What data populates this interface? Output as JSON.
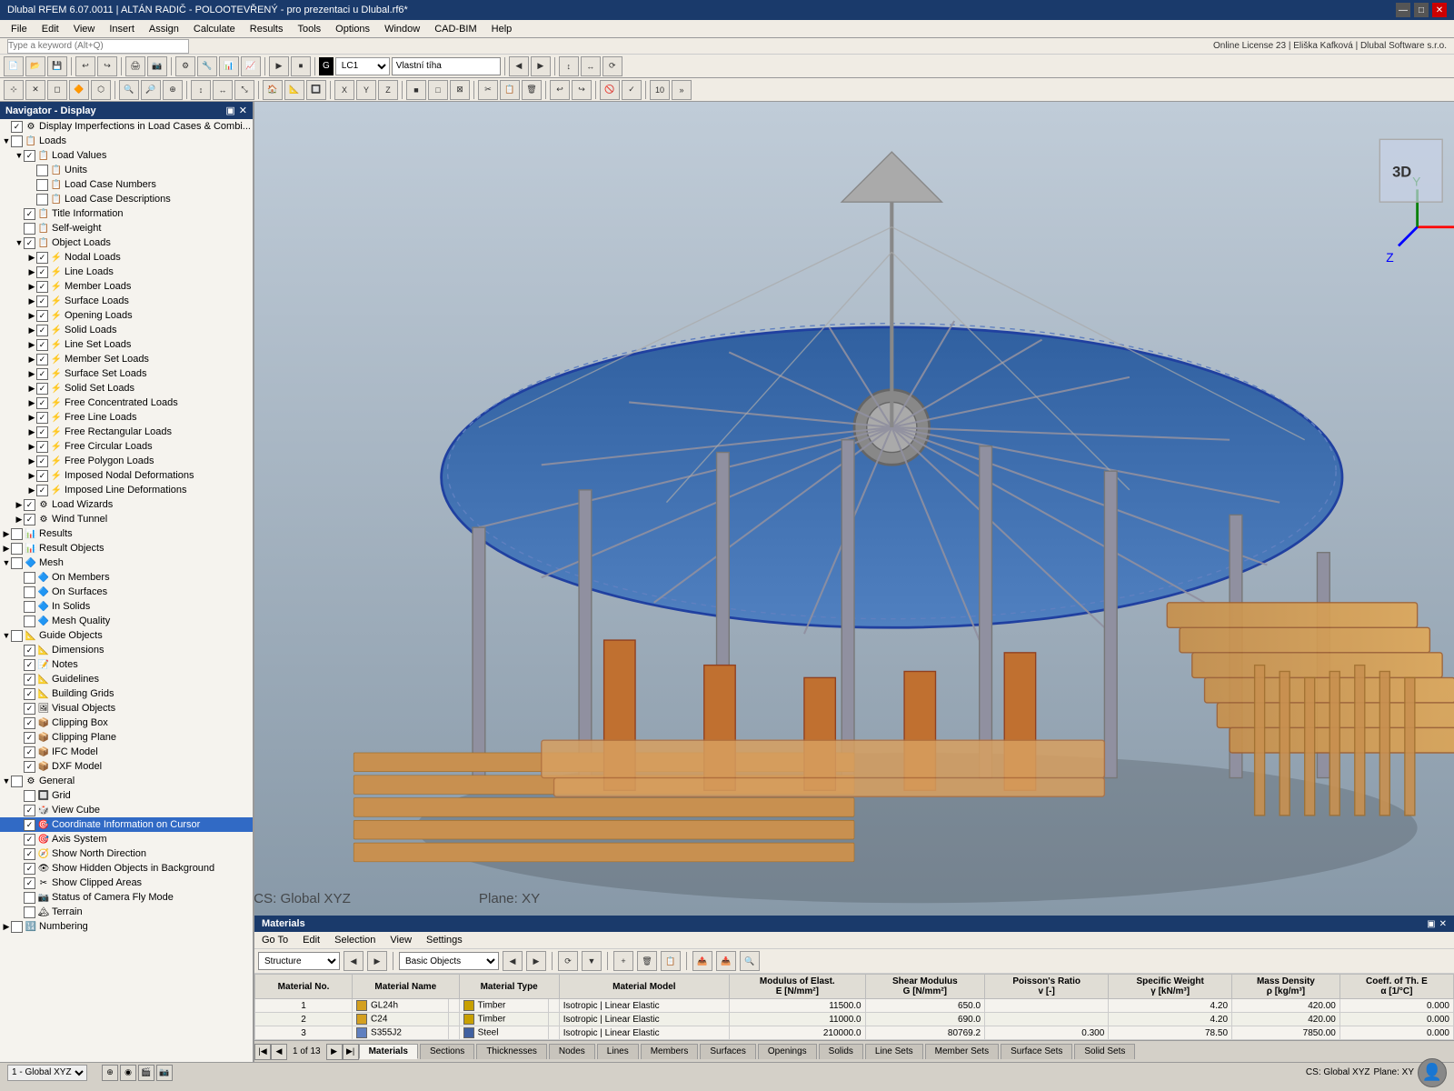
{
  "window": {
    "title": "Dlubal RFEM 6.07.0011 | ALTÁN RADIČ - POLOOTEVŘENÝ - pro prezentaci u Dlubal.rf6*",
    "minimize": "—",
    "maximize": "□",
    "close": "✕"
  },
  "menu": {
    "items": [
      "File",
      "Edit",
      "View",
      "Insert",
      "Assign",
      "Calculate",
      "Results",
      "Tools",
      "Options",
      "Window",
      "CAD-BIM",
      "Help"
    ]
  },
  "license_bar": {
    "search_placeholder": "Type a keyword (Alt+Q)",
    "license_text": "Online License 23 | Eliška Kafková | Dlubal Software s.r.o."
  },
  "toolbar1": {
    "dropdown_lc": "LC1",
    "load_case_name": "Vlastní tíha"
  },
  "navigator": {
    "title": "Navigator - Display",
    "items": [
      {
        "id": "display-imperfections",
        "label": "Display Imperfections in Load Cases & Combi...",
        "checked": true,
        "level": 0,
        "expandable": false,
        "icon": "⚙"
      },
      {
        "id": "loads",
        "label": "Loads",
        "checked": false,
        "level": 0,
        "expandable": true,
        "expanded": true,
        "icon": "📋"
      },
      {
        "id": "load-values",
        "label": "Load Values",
        "checked": true,
        "level": 1,
        "expandable": true,
        "expanded": true,
        "icon": "📋"
      },
      {
        "id": "units",
        "label": "Units",
        "checked": false,
        "level": 2,
        "expandable": false,
        "icon": "📋"
      },
      {
        "id": "load-case-numbers",
        "label": "Load Case Numbers",
        "checked": false,
        "level": 2,
        "expandable": false,
        "icon": "📋"
      },
      {
        "id": "load-case-descriptions",
        "label": "Load Case Descriptions",
        "checked": false,
        "level": 2,
        "expandable": false,
        "icon": "📋"
      },
      {
        "id": "title-information",
        "label": "Title Information",
        "checked": true,
        "level": 1,
        "expandable": false,
        "icon": "📋"
      },
      {
        "id": "self-weight",
        "label": "Self-weight",
        "checked": false,
        "level": 1,
        "expandable": false,
        "icon": "📋"
      },
      {
        "id": "object-loads",
        "label": "Object Loads",
        "checked": true,
        "level": 1,
        "expandable": true,
        "expanded": true,
        "icon": "📋"
      },
      {
        "id": "nodal-loads",
        "label": "Nodal Loads",
        "checked": true,
        "level": 2,
        "expandable": true,
        "icon": "⚡"
      },
      {
        "id": "line-loads",
        "label": "Line Loads",
        "checked": true,
        "level": 2,
        "expandable": true,
        "icon": "⚡"
      },
      {
        "id": "member-loads",
        "label": "Member Loads",
        "checked": true,
        "level": 2,
        "expandable": true,
        "icon": "⚡"
      },
      {
        "id": "surface-loads",
        "label": "Surface Loads",
        "checked": true,
        "level": 2,
        "expandable": true,
        "icon": "⚡"
      },
      {
        "id": "opening-loads",
        "label": "Opening Loads",
        "checked": true,
        "level": 2,
        "expandable": true,
        "icon": "⚡"
      },
      {
        "id": "solid-loads",
        "label": "Solid Loads",
        "checked": true,
        "level": 2,
        "expandable": true,
        "icon": "⚡"
      },
      {
        "id": "line-set-loads",
        "label": "Line Set Loads",
        "checked": true,
        "level": 2,
        "expandable": true,
        "icon": "⚡"
      },
      {
        "id": "member-set-loads",
        "label": "Member Set Loads",
        "checked": true,
        "level": 2,
        "expandable": true,
        "icon": "⚡"
      },
      {
        "id": "surface-set-loads",
        "label": "Surface Set Loads",
        "checked": true,
        "level": 2,
        "expandable": true,
        "icon": "⚡"
      },
      {
        "id": "solid-set-loads",
        "label": "Solid Set Loads",
        "checked": true,
        "level": 2,
        "expandable": true,
        "icon": "⚡"
      },
      {
        "id": "free-concentrated-loads",
        "label": "Free Concentrated Loads",
        "checked": true,
        "level": 2,
        "expandable": true,
        "icon": "⚡"
      },
      {
        "id": "free-line-loads",
        "label": "Free Line Loads",
        "checked": true,
        "level": 2,
        "expandable": true,
        "icon": "⚡"
      },
      {
        "id": "free-rectangular-loads",
        "label": "Free Rectangular Loads",
        "checked": true,
        "level": 2,
        "expandable": true,
        "icon": "⚡"
      },
      {
        "id": "free-circular-loads",
        "label": "Free Circular Loads",
        "checked": true,
        "level": 2,
        "expandable": true,
        "icon": "⚡"
      },
      {
        "id": "free-polygon-loads",
        "label": "Free Polygon Loads",
        "checked": true,
        "level": 2,
        "expandable": true,
        "icon": "⚡"
      },
      {
        "id": "imposed-nodal",
        "label": "Imposed Nodal Deformations",
        "checked": true,
        "level": 2,
        "expandable": true,
        "icon": "⚡"
      },
      {
        "id": "imposed-line",
        "label": "Imposed Line Deformations",
        "checked": true,
        "level": 2,
        "expandable": true,
        "icon": "⚡"
      },
      {
        "id": "load-wizards",
        "label": "Load Wizards",
        "checked": true,
        "level": 1,
        "expandable": true,
        "icon": "⚙"
      },
      {
        "id": "wind-tunnel",
        "label": "Wind Tunnel",
        "checked": true,
        "level": 1,
        "expandable": true,
        "icon": "⚙"
      },
      {
        "id": "results",
        "label": "Results",
        "checked": false,
        "level": 0,
        "expandable": true,
        "expanded": false,
        "icon": "📊"
      },
      {
        "id": "result-objects",
        "label": "Result Objects",
        "checked": false,
        "level": 0,
        "expandable": true,
        "expanded": false,
        "icon": "📊"
      },
      {
        "id": "mesh",
        "label": "Mesh",
        "checked": false,
        "level": 0,
        "expandable": true,
        "expanded": true,
        "icon": "🔷"
      },
      {
        "id": "on-members",
        "label": "On Members",
        "checked": false,
        "level": 1,
        "expandable": false,
        "icon": "🔷"
      },
      {
        "id": "on-surfaces",
        "label": "On Surfaces",
        "checked": false,
        "level": 1,
        "expandable": false,
        "icon": "🔷"
      },
      {
        "id": "in-solids",
        "label": "In Solids",
        "checked": false,
        "level": 1,
        "expandable": false,
        "icon": "🔷"
      },
      {
        "id": "mesh-quality",
        "label": "Mesh Quality",
        "checked": false,
        "level": 1,
        "expandable": false,
        "icon": "🔷"
      },
      {
        "id": "guide-objects",
        "label": "Guide Objects",
        "checked": false,
        "level": 0,
        "expandable": true,
        "expanded": true,
        "icon": "📐"
      },
      {
        "id": "dimensions",
        "label": "Dimensions",
        "checked": true,
        "level": 1,
        "expandable": false,
        "icon": "📐"
      },
      {
        "id": "notes",
        "label": "Notes",
        "checked": true,
        "level": 1,
        "expandable": false,
        "icon": "📝"
      },
      {
        "id": "guidelines",
        "label": "Guidelines",
        "checked": true,
        "level": 1,
        "expandable": false,
        "icon": "📐"
      },
      {
        "id": "building-grids",
        "label": "Building Grids",
        "checked": true,
        "level": 1,
        "expandable": false,
        "icon": "📐"
      },
      {
        "id": "visual-objects",
        "label": "Visual Objects",
        "checked": true,
        "level": 1,
        "expandable": false,
        "icon": "🖼"
      },
      {
        "id": "clipping-box",
        "label": "Clipping Box",
        "checked": true,
        "level": 1,
        "expandable": false,
        "icon": "📦"
      },
      {
        "id": "clipping-plane",
        "label": "Clipping Plane",
        "checked": true,
        "level": 1,
        "expandable": false,
        "icon": "📦"
      },
      {
        "id": "ifc-model",
        "label": "IFC Model",
        "checked": true,
        "level": 1,
        "expandable": false,
        "icon": "📦"
      },
      {
        "id": "dxf-model",
        "label": "DXF Model",
        "checked": true,
        "level": 1,
        "expandable": false,
        "icon": "📦"
      },
      {
        "id": "general",
        "label": "General",
        "checked": false,
        "level": 0,
        "expandable": true,
        "expanded": true,
        "icon": "⚙"
      },
      {
        "id": "grid",
        "label": "Grid",
        "checked": false,
        "level": 1,
        "expandable": false,
        "icon": "🔲"
      },
      {
        "id": "view-cube",
        "label": "View Cube",
        "checked": true,
        "level": 1,
        "expandable": false,
        "icon": "🎲"
      },
      {
        "id": "coord-info",
        "label": "Coordinate Information on Cursor",
        "checked": true,
        "level": 1,
        "expandable": false,
        "selected": true,
        "icon": "🎯"
      },
      {
        "id": "axis-system",
        "label": "Axis System",
        "checked": true,
        "level": 1,
        "expandable": false,
        "icon": "🎯"
      },
      {
        "id": "show-north",
        "label": "Show North Direction",
        "checked": true,
        "level": 1,
        "expandable": false,
        "icon": "🧭"
      },
      {
        "id": "show-hidden",
        "label": "Show Hidden Objects in Background",
        "checked": true,
        "level": 1,
        "expandable": false,
        "icon": "👁"
      },
      {
        "id": "show-clipped",
        "label": "Show Clipped Areas",
        "checked": true,
        "level": 1,
        "expandable": false,
        "icon": "✂"
      },
      {
        "id": "status-camera",
        "label": "Status of Camera Fly Mode",
        "checked": false,
        "level": 1,
        "expandable": false,
        "icon": "📷"
      },
      {
        "id": "terrain",
        "label": "Terrain",
        "checked": false,
        "level": 1,
        "expandable": false,
        "icon": "🏔"
      },
      {
        "id": "numbering",
        "label": "Numbering",
        "checked": false,
        "level": 0,
        "expandable": true,
        "expanded": false,
        "icon": "🔢"
      }
    ]
  },
  "materials_panel": {
    "title": "Materials",
    "menu_items": [
      "Go To",
      "Edit",
      "Selection",
      "View",
      "Settings"
    ],
    "toolbar": {
      "filter_label": "Structure",
      "filter2_label": "Basic Objects"
    },
    "table": {
      "columns": [
        "Material No.",
        "Material Name",
        "",
        "Material Type",
        "",
        "Material Model",
        "Modulus of Elast. E [N/mm²]",
        "Shear Modulus G [N/mm²]",
        "Poisson's Ratio v [-]",
        "Specific Weight γ [kN/m³]",
        "Mass Density ρ [kg/m³]",
        "Coeff. of Th. E α [1/°C]"
      ],
      "rows": [
        {
          "no": 1,
          "name": "GL24h",
          "color": "#d4a020",
          "type": "Timber",
          "type_color": "#c8a000",
          "model": "Isotropic | Linear Elastic",
          "E": "11500.0",
          "G": "650.0",
          "v": "",
          "gamma": "4.20",
          "rho": "420.00",
          "alpha": "0.000"
        },
        {
          "no": 2,
          "name": "C24",
          "color": "#d4a020",
          "type": "Timber",
          "type_color": "#c8a000",
          "model": "Isotropic | Linear Elastic",
          "E": "11000.0",
          "G": "690.0",
          "v": "",
          "gamma": "4.20",
          "rho": "420.00",
          "alpha": "0.000"
        },
        {
          "no": 3,
          "name": "S355J2",
          "color": "#6080c0",
          "type": "Steel",
          "type_color": "#4060a0",
          "model": "Isotropic | Linear Elastic",
          "E": "210000.0",
          "G": "80769.2",
          "v": "0.300",
          "gamma": "78.50",
          "rho": "7850.00",
          "alpha": "0.000"
        }
      ]
    }
  },
  "bottom_tabs": {
    "tabs": [
      "Materials",
      "Sections",
      "Thicknesses",
      "Nodes",
      "Lines",
      "Members",
      "Surfaces",
      "Openings",
      "Solids",
      "Line Sets",
      "Member Sets",
      "Surface Sets",
      "Solid Sets"
    ],
    "active": "Materials",
    "pagination": {
      "current": 1,
      "total": 13
    }
  },
  "status_bar": {
    "left": "1 - Global XYZ",
    "coord_system": "CS: Global XYZ",
    "plane": "Plane: XY"
  }
}
